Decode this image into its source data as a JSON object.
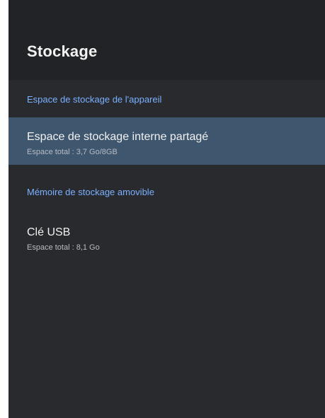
{
  "screen": {
    "title": "Stockage"
  },
  "sections": [
    {
      "header": "Espace de stockage de l'appareil",
      "items": [
        {
          "title": "Espace de stockage interne partagé",
          "subtitle": "Espace total : 3,7 Go/8GB",
          "focused": true
        }
      ]
    },
    {
      "header": "Mémoire de stockage amovible",
      "items": [
        {
          "title": "Clé USB",
          "subtitle": "Espace total : 8,1 Go",
          "focused": false
        }
      ]
    }
  ],
  "colors": {
    "background": "#292a2e",
    "header_background": "#222326",
    "section_header": "#7ab1ff",
    "focused_item": "#3f566f"
  }
}
